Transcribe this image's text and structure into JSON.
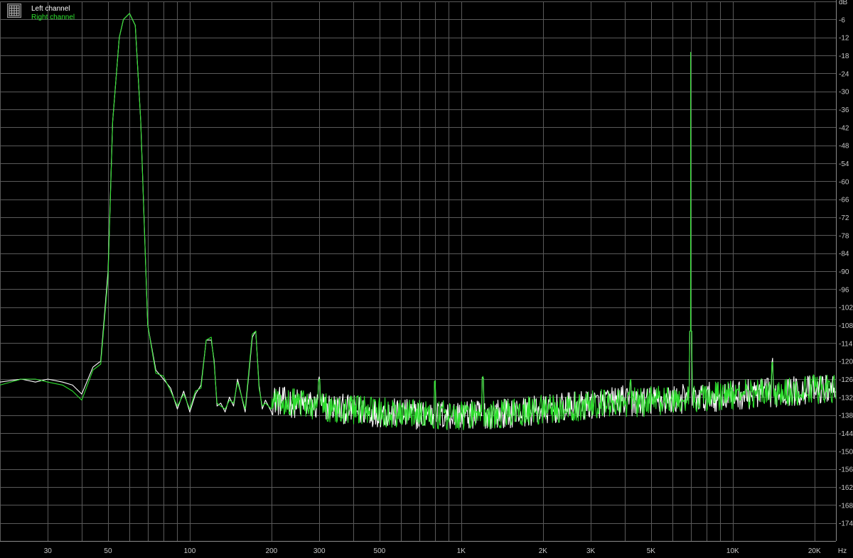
{
  "chart_data": {
    "type": "line",
    "title": "",
    "xlabel": "",
    "ylabel": "",
    "x_unit": "Hz",
    "y_unit": "dB",
    "x_scale": "log",
    "xlim": [
      20,
      24000
    ],
    "ylim": [
      -180,
      0
    ],
    "grid": true,
    "legend_position": "top-left",
    "colors": {
      "background": "#000000",
      "grid": "#5a5a5a",
      "left": "#ffffff",
      "right": "#2ee02e",
      "tick_text": "#c8c8c8"
    },
    "y_ticks": [
      "dB",
      "-6",
      "-12",
      "-18",
      "-24",
      "-30",
      "-36",
      "-42",
      "-48",
      "-54",
      "-60",
      "-66",
      "-72",
      "-78",
      "-84",
      "-90",
      "-96",
      "-102",
      "-108",
      "-114",
      "-120",
      "-126",
      "-132",
      "-138",
      "-144",
      "-150",
      "-156",
      "-162",
      "-168",
      "-174"
    ],
    "x_ticks": [
      {
        "label": "30",
        "value": 30
      },
      {
        "label": "50",
        "value": 50
      },
      {
        "label": "100",
        "value": 100
      },
      {
        "label": "200",
        "value": 200
      },
      {
        "label": "300",
        "value": 300
      },
      {
        "label": "500",
        "value": 500
      },
      {
        "label": "1K",
        "value": 1000
      },
      {
        "label": "2K",
        "value": 2000
      },
      {
        "label": "3K",
        "value": 3000
      },
      {
        "label": "5K",
        "value": 5000
      },
      {
        "label": "10K",
        "value": 10000
      },
      {
        "label": "20K",
        "value": 20000
      },
      {
        "label": "Hz",
        "value": 24000
      }
    ],
    "series": [
      {
        "name": "Left channel",
        "x": [
          20,
          24,
          27,
          30,
          34,
          37,
          40,
          44,
          47,
          50,
          52,
          55,
          57,
          60,
          63,
          66,
          70,
          75,
          80,
          85,
          90,
          95,
          100,
          105,
          110,
          115,
          120,
          123,
          126,
          130,
          135,
          140,
          145,
          150,
          160,
          170,
          175,
          180,
          185,
          190,
          200
        ],
        "y": [
          -127,
          -126,
          -127,
          -126,
          -127,
          -128,
          -131,
          -122,
          -120,
          -90,
          -40,
          -12,
          -6,
          -4,
          -8,
          -40,
          -108,
          -123,
          -126,
          -129,
          -136,
          -130,
          -137,
          -131,
          -128,
          -113,
          -113,
          -120,
          -135,
          -134,
          -137,
          -132,
          -135,
          -126,
          -137,
          -112,
          -110,
          -128,
          -136,
          -133,
          -137
        ]
      },
      {
        "name": "Right channel",
        "x": [
          20,
          24,
          27,
          30,
          34,
          37,
          40,
          44,
          47,
          50,
          52,
          55,
          57,
          60,
          63,
          66,
          70,
          75,
          80,
          85,
          90,
          95,
          100,
          105,
          110,
          115,
          120,
          123,
          126,
          130,
          135,
          140,
          145,
          150,
          160,
          170,
          175,
          180,
          185,
          190,
          200
        ],
        "y": [
          -128,
          -126,
          -126,
          -127,
          -128,
          -130,
          -133,
          -123,
          -121,
          -92,
          -40,
          -12,
          -6,
          -4,
          -8,
          -40,
          -108,
          -124,
          -125,
          -130,
          -135,
          -131,
          -136,
          -130,
          -129,
          -113,
          -112,
          -121,
          -134,
          -135,
          -136,
          -133,
          -134,
          -127,
          -136,
          -111,
          -110,
          -129,
          -135,
          -134,
          -136
        ]
      }
    ],
    "noise_floor": {
      "from_hz": 200,
      "to_hz": 24000,
      "level_db": [
        -140,
        -128
      ],
      "variation_db": 10
    },
    "spur_peaks": [
      {
        "hz": 300,
        "db": -126
      },
      {
        "hz": 800,
        "db": -126
      },
      {
        "hz": 1200,
        "db": -126
      },
      {
        "hz": 4200,
        "db": -126
      },
      {
        "hz": 14000,
        "db": -120
      }
    ],
    "tone_peak": {
      "hz": 7000,
      "db": -17,
      "sideband_db": -110
    }
  },
  "legend": {
    "left_label": "Left channel",
    "right_label": "Right channel"
  },
  "grid_icon": "grid-icon"
}
